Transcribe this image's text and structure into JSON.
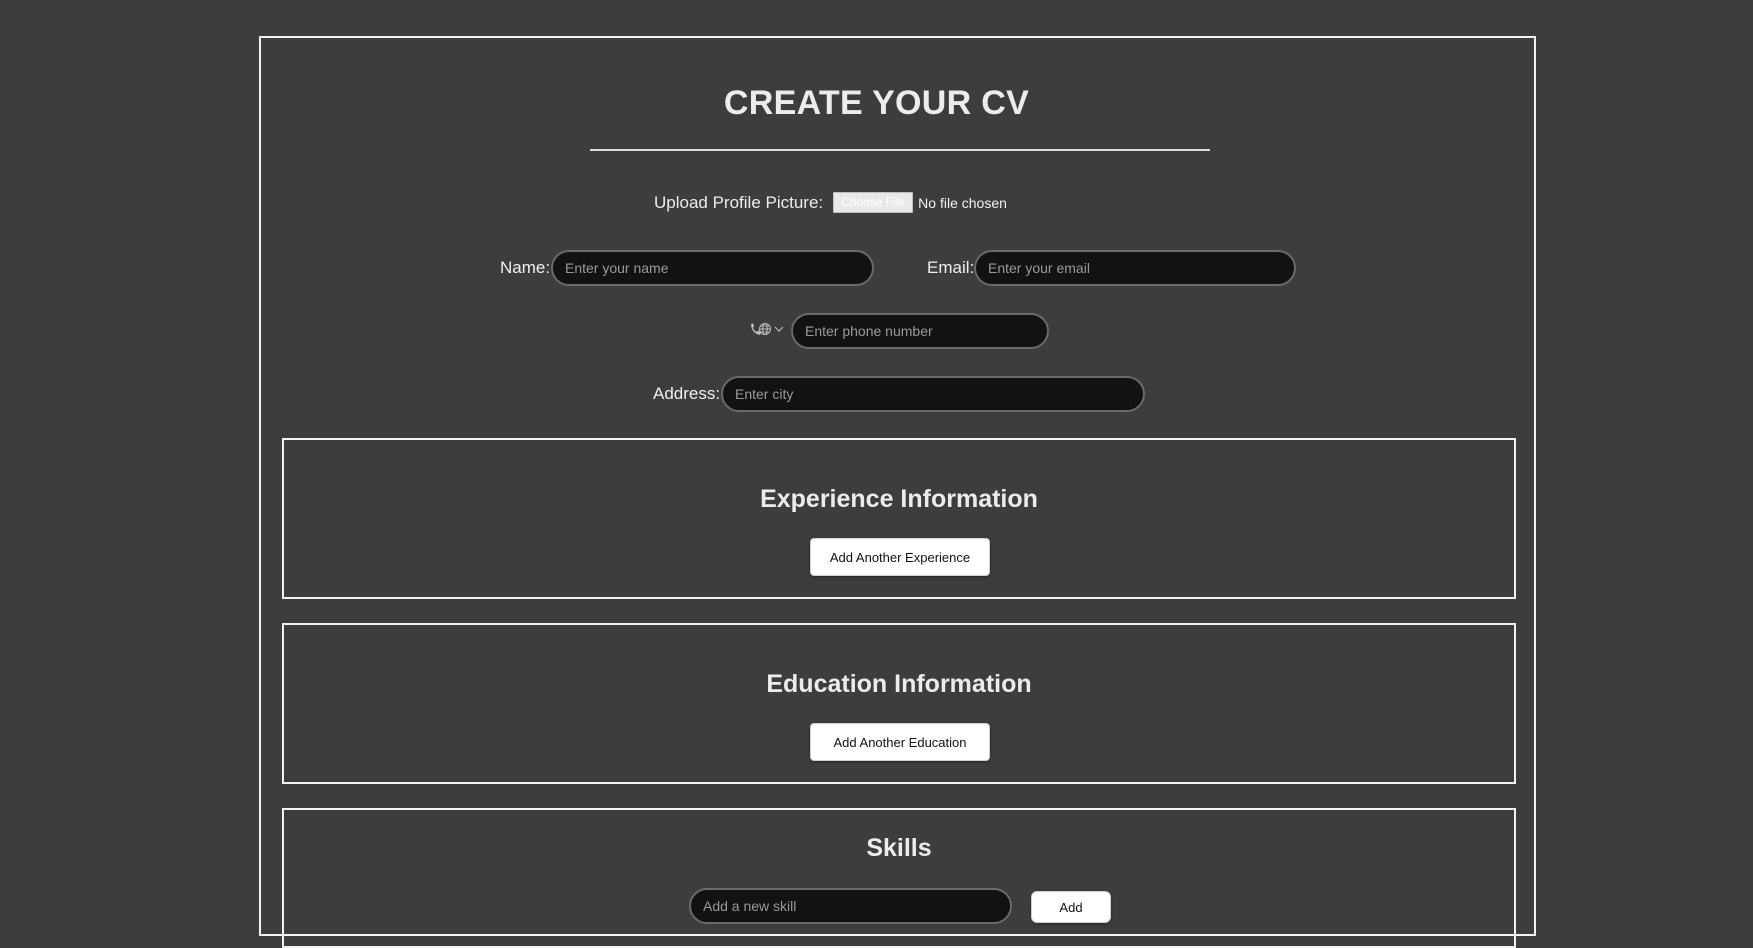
{
  "page": {
    "title": "CREATE YOUR CV"
  },
  "upload": {
    "label": "Upload Profile Picture:",
    "button_label": "Choose File",
    "status": "No file chosen"
  },
  "fields": {
    "name_label": "Name:",
    "name_placeholder": "Enter your name",
    "email_label": "Email:",
    "email_placeholder": "Enter your email",
    "phone_placeholder": "Enter phone number",
    "address_label": "Address:",
    "address_placeholder": "Enter city"
  },
  "icons": {
    "phone": "phone-globe-icon",
    "dropdown": "chevron-down-icon"
  },
  "sections": {
    "experience": {
      "title": "Experience Information",
      "button_label": "Add Another Experience"
    },
    "education": {
      "title": "Education Information",
      "button_label": "Add Another Education"
    },
    "skills": {
      "title": "Skills",
      "input_placeholder": "Add a new skill",
      "button_label": "Add"
    }
  },
  "colors": {
    "background": "#3d3d3d",
    "input_background": "#121212",
    "border": "#f2f2f2"
  }
}
